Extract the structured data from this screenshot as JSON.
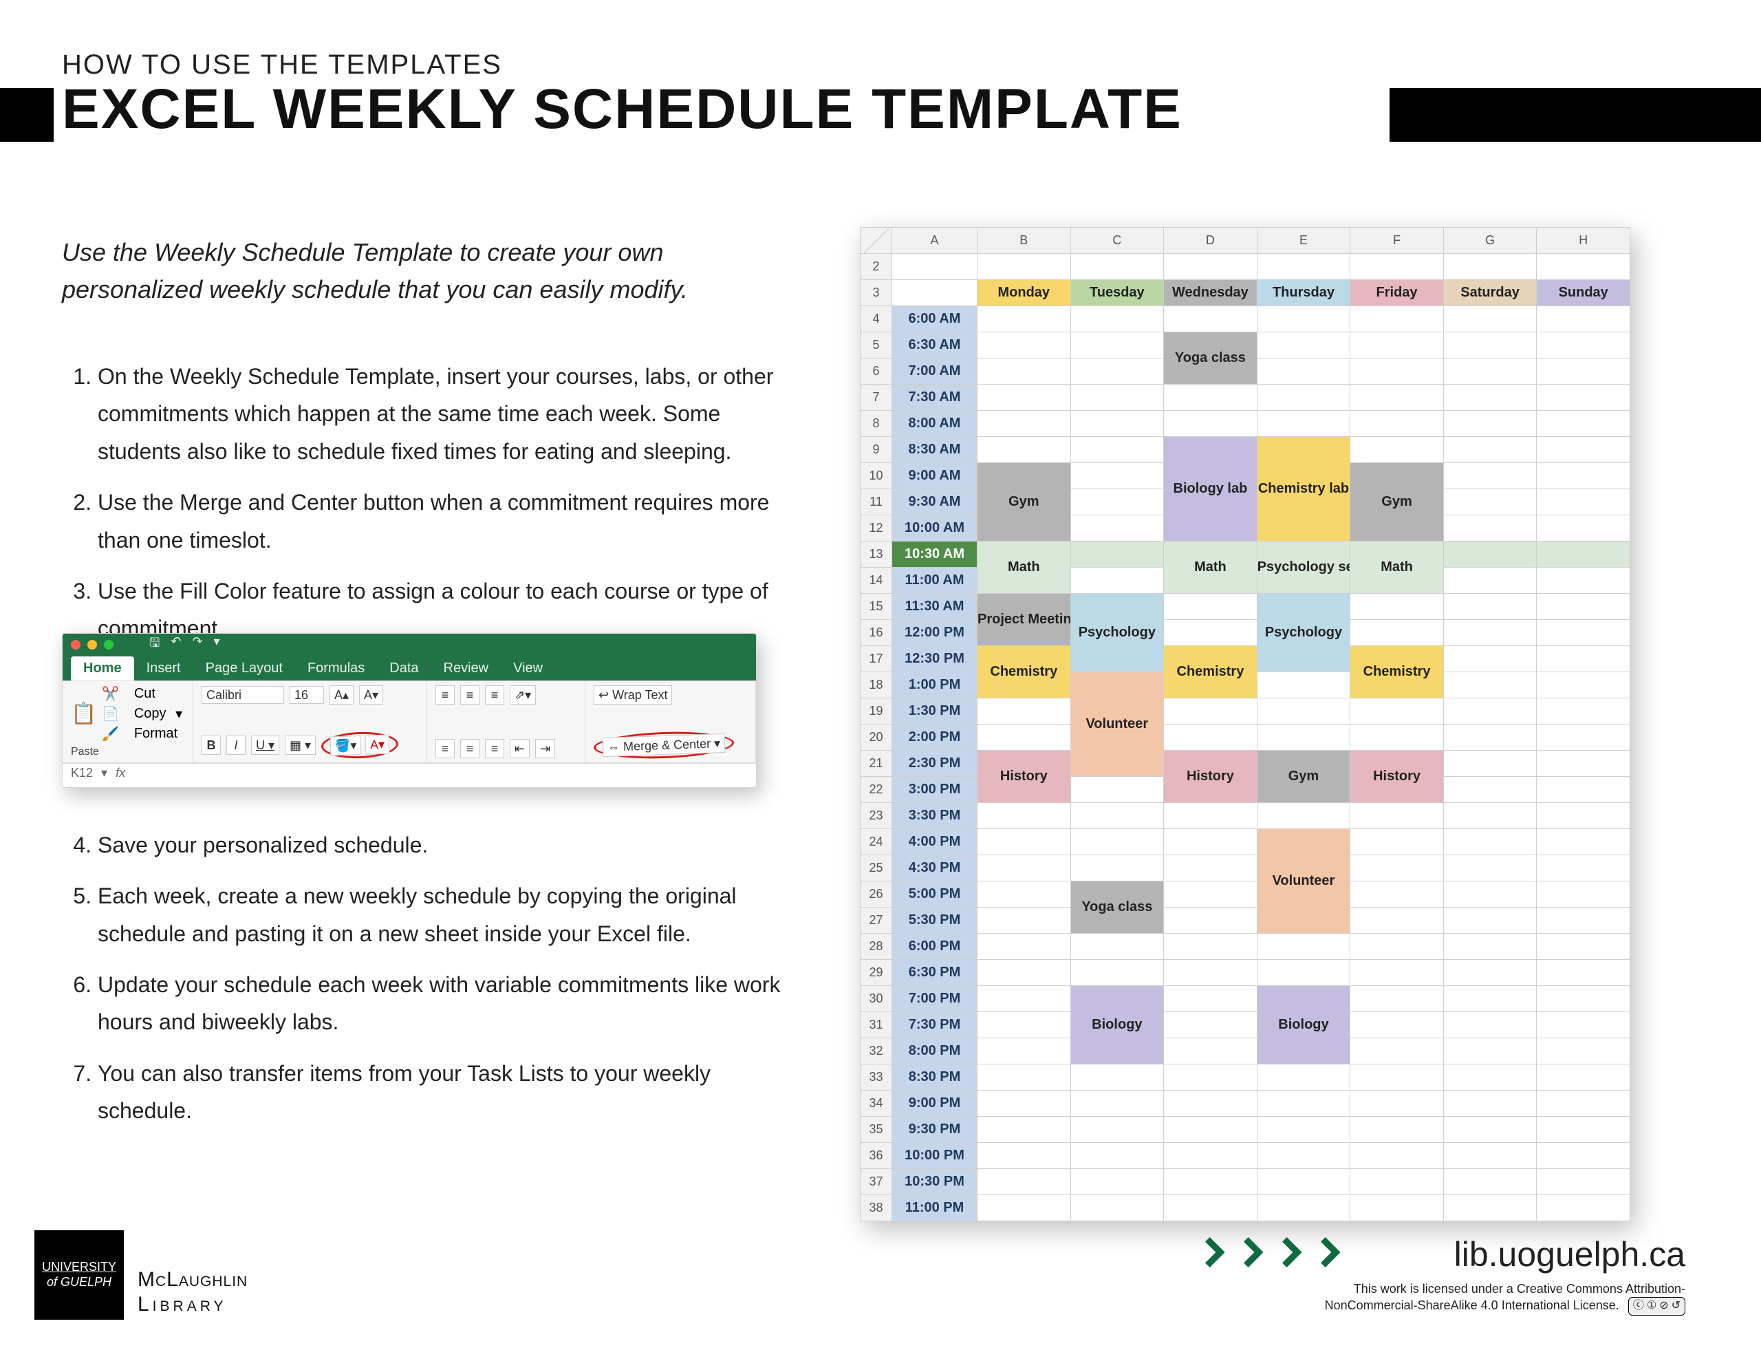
{
  "header": {
    "overline": "HOW TO USE THE TEMPLATES",
    "title": "EXCEL WEEKLY SCHEDULE TEMPLATE"
  },
  "intro": "Use the Weekly Schedule Template to create your own personalized weekly schedule that you can easily modify.",
  "steps": [
    "On the Weekly Schedule Template, insert your courses, labs, or other commitments which happen at the same time each week.  Some students also like to schedule fixed times for eating and sleeping.",
    "Use the Merge and Center button when a commitment requires more than one timeslot.",
    "Use the Fill Color feature to assign a colour to each course or type of commitment.",
    "Save your personalized schedule.",
    "Each week, create a new weekly schedule by copying the original schedule and pasting it on a new sheet inside your Excel file.",
    "Update your schedule each week with variable commitments like work hours and biweekly labs.",
    "You can also transfer items from your Task Lists to your weekly schedule."
  ],
  "ribbon": {
    "tabs": [
      "Home",
      "Insert",
      "Page Layout",
      "Formulas",
      "Data",
      "Review",
      "View"
    ],
    "active_tab": "Home",
    "clipboard_label": "Paste",
    "cut": "Cut",
    "copy": "Copy",
    "format": "Format",
    "font_name": "Calibri",
    "font_size": "16",
    "wrap": "Wrap Text",
    "merge": "Merge & Center",
    "cell_ref": "K12",
    "fx": "fx"
  },
  "schedule": {
    "columns": [
      "A",
      "B",
      "C",
      "D",
      "E",
      "F",
      "G",
      "H"
    ],
    "row_numbers": [
      2,
      3,
      4,
      5,
      6,
      7,
      8,
      9,
      10,
      11,
      12,
      13,
      14,
      15,
      16,
      17,
      18,
      19,
      20,
      21,
      22,
      23,
      24,
      25,
      26,
      27,
      28,
      29,
      30,
      31,
      32,
      33,
      34,
      35,
      36,
      37,
      38
    ],
    "days": [
      "Monday",
      "Tuesday",
      "Wednesday",
      "Thursday",
      "Friday",
      "Saturday",
      "Sunday"
    ],
    "times": [
      "6:00 AM",
      "6:30 AM",
      "7:00 AM",
      "7:30 AM",
      "8:00 AM",
      "8:30 AM",
      "9:00 AM",
      "9:30 AM",
      "10:00 AM",
      "10:30 AM",
      "11:00 AM",
      "11:30 AM",
      "12:00 PM",
      "12:30 PM",
      "1:00 PM",
      "1:30 PM",
      "2:00 PM",
      "2:30 PM",
      "3:00 PM",
      "3:30 PM",
      "4:00 PM",
      "4:30 PM",
      "5:00 PM",
      "5:30 PM",
      "6:00 PM",
      "6:30 PM",
      "7:00 PM",
      "7:30 PM",
      "8:00 PM",
      "8:30 PM",
      "9:00 PM",
      "9:30 PM",
      "10:00 PM",
      "10:30 PM",
      "11:00 PM"
    ],
    "selected_time_row": "10:30 AM",
    "events": [
      {
        "label": "Yoga class",
        "day": "Wednesday",
        "start": "6:30 AM",
        "span": 2,
        "cls": "ev-gray"
      },
      {
        "label": "Biology lab",
        "day": "Wednesday",
        "start": "8:30 AM",
        "span": 4,
        "cls": "ev-purple"
      },
      {
        "label": "Chemistry lab",
        "day": "Thursday",
        "start": "8:30 AM",
        "span": 4,
        "cls": "ev-yellow"
      },
      {
        "label": "Gym",
        "day": "Monday",
        "start": "9:00 AM",
        "span": 3,
        "cls": "ev-gray"
      },
      {
        "label": "Gym",
        "day": "Friday",
        "start": "9:00 AM",
        "span": 3,
        "cls": "ev-gray"
      },
      {
        "label": "Math",
        "day": "Monday",
        "start": "10:30 AM",
        "span": 2,
        "cls": "ev-green"
      },
      {
        "label": "Math",
        "day": "Wednesday",
        "start": "10:30 AM",
        "span": 2,
        "cls": "ev-green"
      },
      {
        "label": "Psychology seminar",
        "day": "Thursday",
        "start": "10:30 AM",
        "span": 2,
        "cls": "ev-blue"
      },
      {
        "label": "Math",
        "day": "Friday",
        "start": "10:30 AM",
        "span": 2,
        "cls": "ev-green"
      },
      {
        "label": "Project Meeting",
        "day": "Monday",
        "start": "11:30 AM",
        "span": 2,
        "cls": "ev-gray"
      },
      {
        "label": "Psychology",
        "day": "Tuesday",
        "start": "11:30 AM",
        "span": 3,
        "cls": "ev-blue"
      },
      {
        "label": "Psychology",
        "day": "Thursday",
        "start": "11:30 AM",
        "span": 3,
        "cls": "ev-blue"
      },
      {
        "label": "Chemistry",
        "day": "Monday",
        "start": "12:30 PM",
        "span": 2,
        "cls": "ev-yellow"
      },
      {
        "label": "Chemistry",
        "day": "Wednesday",
        "start": "12:30 PM",
        "span": 2,
        "cls": "ev-yellow"
      },
      {
        "label": "Chemistry",
        "day": "Friday",
        "start": "12:30 PM",
        "span": 2,
        "cls": "ev-yellow"
      },
      {
        "label": "Volunteer",
        "day": "Tuesday",
        "start": "1:00 PM",
        "span": 4,
        "cls": "ev-peach"
      },
      {
        "label": "History",
        "day": "Monday",
        "start": "2:30 PM",
        "span": 2,
        "cls": "ev-rose"
      },
      {
        "label": "History",
        "day": "Wednesday",
        "start": "2:30 PM",
        "span": 2,
        "cls": "ev-rose"
      },
      {
        "label": "Gym",
        "day": "Thursday",
        "start": "2:30 PM",
        "span": 2,
        "cls": "ev-gray"
      },
      {
        "label": "History",
        "day": "Friday",
        "start": "2:30 PM",
        "span": 2,
        "cls": "ev-rose"
      },
      {
        "label": "Volunteer",
        "day": "Thursday",
        "start": "4:00 PM",
        "span": 4,
        "cls": "ev-peach"
      },
      {
        "label": "Yoga class",
        "day": "Tuesday",
        "start": "5:00 PM",
        "span": 2,
        "cls": "ev-gray"
      },
      {
        "label": "Biology",
        "day": "Tuesday",
        "start": "7:00 PM",
        "span": 3,
        "cls": "ev-purple"
      },
      {
        "label": "Biology",
        "day": "Thursday",
        "start": "7:00 PM",
        "span": 3,
        "cls": "ev-purple"
      }
    ]
  },
  "footer": {
    "uni_line1": "UNIVERSITY",
    "uni_line2": "of GUELPH",
    "library_top": "McLaughlin",
    "library_bot": "Library",
    "site": "lib.uoguelph.ca",
    "cc_text": "This work is licensed under a Creative Commons Attribution-\nNonCommercial-ShareAlike 4.0 International License.",
    "cc_badge": "CC BY-NC-SA"
  }
}
